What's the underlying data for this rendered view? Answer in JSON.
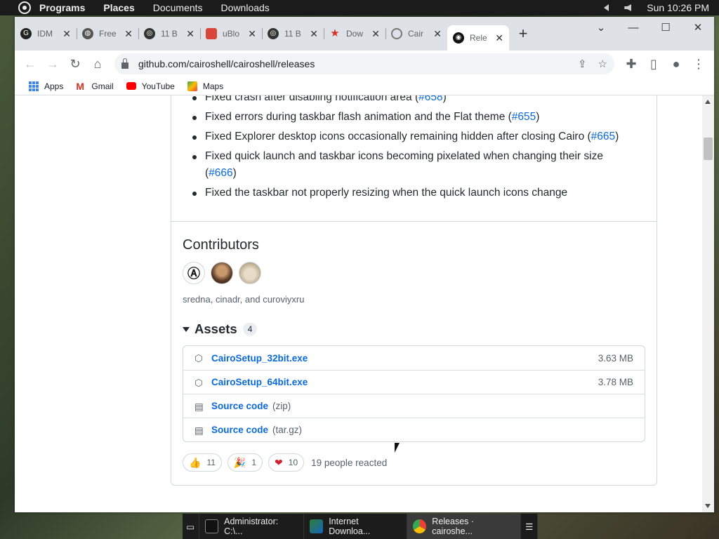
{
  "desktop": {
    "menus": [
      "Programs",
      "Places",
      "Documents",
      "Downloads"
    ],
    "clock": "Sun 10:26 PM"
  },
  "browser": {
    "tabs": [
      {
        "label": "IDM",
        "icon": "google-g-icon"
      },
      {
        "label": "Free",
        "icon": "globe-icon"
      },
      {
        "label": "11 B",
        "icon": "target-icon"
      },
      {
        "label": "uBlo",
        "icon": "chrome-store-icon"
      },
      {
        "label": "11 B",
        "icon": "target-icon"
      },
      {
        "label": "Dow",
        "icon": "star-icon"
      },
      {
        "label": "Cair",
        "icon": "loading-icon"
      },
      {
        "label": "Rele",
        "icon": "github-icon"
      }
    ],
    "url": "github.com/cairoshell/cairoshell/releases",
    "bookmarks": [
      "Apps",
      "Gmail",
      "YouTube",
      "Maps"
    ]
  },
  "release": {
    "notes": [
      {
        "text": "Fixed crash after disabling notification area (",
        "link": "#658",
        "tail": ")"
      },
      {
        "text": "Fixed errors during taskbar flash animation and the Flat theme (",
        "link": "#655",
        "tail": ")"
      },
      {
        "text": "Fixed Explorer desktop icons occasionally remaining hidden after closing Cairo (",
        "link": "#665",
        "tail": ")"
      },
      {
        "text": "Fixed quick launch and taskbar icons becoming pixelated when changing their size (",
        "link": "#666",
        "tail": ")"
      },
      {
        "text": "Fixed the taskbar not properly resizing when the quick launch icons change",
        "link": "",
        "tail": ""
      }
    ],
    "contributors_title": "Contributors",
    "contributors_names": "sredna, cinadr, and curoviyxru",
    "assets_title": "Assets",
    "assets_count": "4",
    "assets": [
      {
        "name": "CairoSetup_32bit.exe",
        "ext": "",
        "size": "3.63 MB",
        "icon": "package-icon"
      },
      {
        "name": "CairoSetup_64bit.exe",
        "ext": "",
        "size": "3.78 MB",
        "icon": "package-icon"
      },
      {
        "name": "Source code",
        "ext": "(zip)",
        "size": "",
        "icon": "file-zip-icon"
      },
      {
        "name": "Source code",
        "ext": "(tar.gz)",
        "size": "",
        "icon": "file-zip-icon"
      }
    ],
    "reactions": [
      {
        "emoji": "👍",
        "count": "11"
      },
      {
        "emoji": "🎉",
        "count": "1"
      },
      {
        "emoji": "❤",
        "count": "10"
      }
    ],
    "reactions_summary": "19 people reacted"
  },
  "taskbar": [
    {
      "label": "Administrator: C:\\...",
      "icon": "terminal-icon"
    },
    {
      "label": "Internet Downloa...",
      "icon": "idm-icon"
    },
    {
      "label": "Releases · cairoshe...",
      "icon": "chrome-icon"
    }
  ]
}
